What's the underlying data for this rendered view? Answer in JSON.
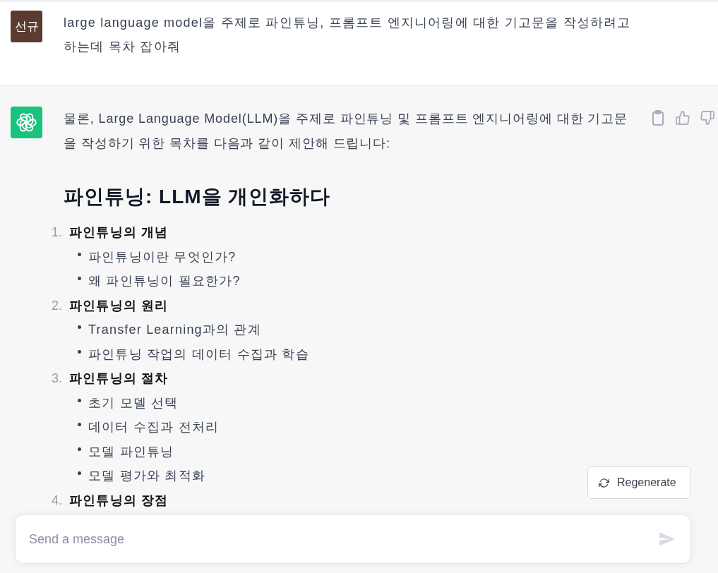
{
  "user_message": {
    "avatar_text": "선규",
    "text": "large language model을 주제로 파인튜닝, 프롬프트 엔지니어링에 대한 기고문을 작성하려고 하는데 목차 잡아줘"
  },
  "assistant_message": {
    "intro": "물론, Large Language Model(LLM)을 주제로 파인튜닝 및 프롬프트 엔지니어링에 대한 기고문을 작성하기 위한 목차를 다음과 같이 제안해 드립니다:",
    "heading": "파인튜닝: LLM을 개인화하다",
    "outline": [
      {
        "number": "1.",
        "title": "파인튜닝의 개념",
        "children": [
          {
            "text": "파인튜닝이란 무엇인가?"
          },
          {
            "text": "왜 파인튜닝이 필요한가?"
          }
        ]
      },
      {
        "number": "2.",
        "title": "파인튜닝의 원리",
        "children": [
          {
            "text": "Transfer Learning과의 관계"
          },
          {
            "text": "파인튜닝 작업의 데이터 수집과 학습"
          }
        ]
      },
      {
        "number": "3.",
        "title": "파인튜닝의 절차",
        "children": [
          {
            "text": "초기 모델 선택"
          },
          {
            "text": "데이터 수집과 전처리"
          },
          {
            "text": "모델 파인튜닝"
          },
          {
            "text": "모델 평가와 최적화"
          }
        ]
      },
      {
        "number": "4.",
        "title": "파인튜닝의 장점"
      }
    ]
  },
  "regenerate_button": {
    "label": "Regenerate"
  },
  "composer": {
    "placeholder": "Send a message",
    "send_disabled": true
  }
}
